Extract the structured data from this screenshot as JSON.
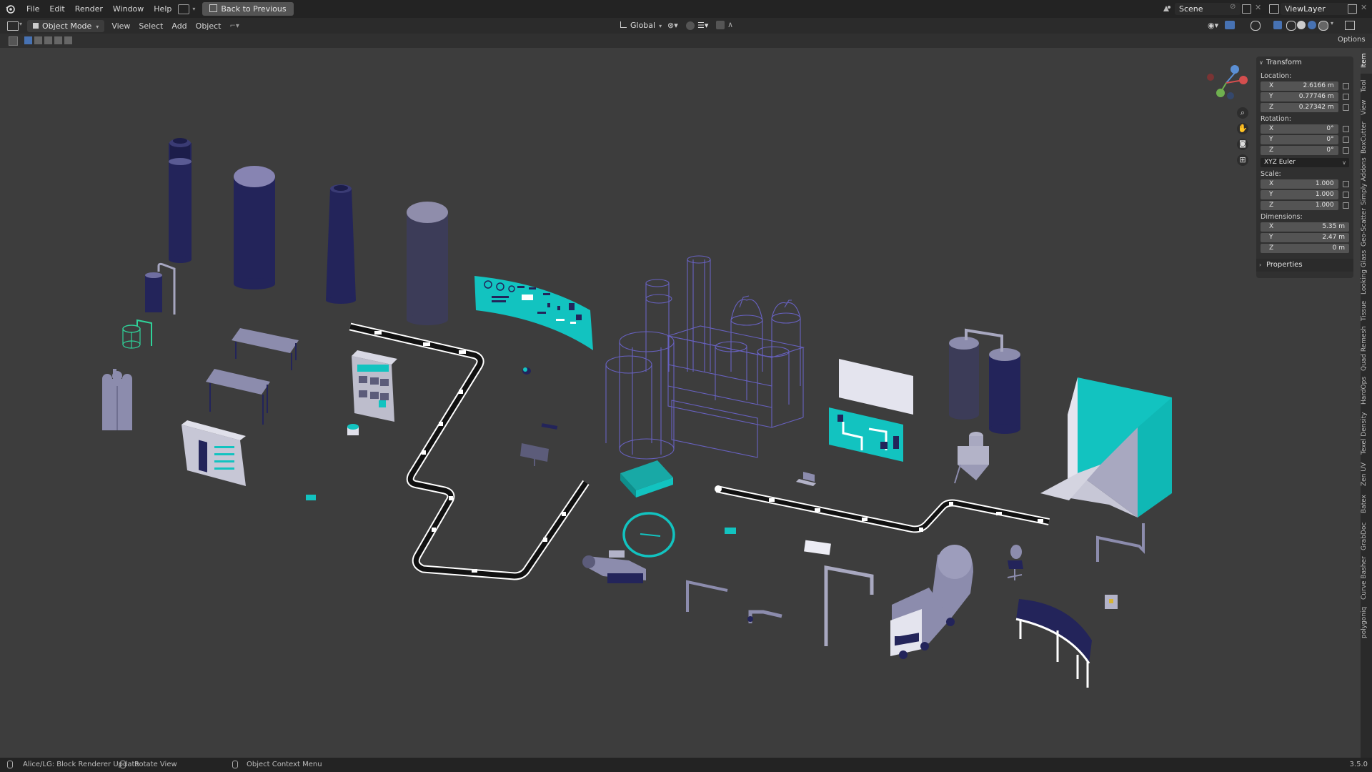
{
  "menu": {
    "items": [
      "File",
      "Edit",
      "Render",
      "Window",
      "Help"
    ],
    "back_label": "Back to Previous"
  },
  "scene": {
    "name": "Scene"
  },
  "view_layer": {
    "name": "ViewLayer"
  },
  "header": {
    "mode": "Object Mode",
    "menus": [
      "View",
      "Select",
      "Add",
      "Object"
    ],
    "transform_orientation": "Global",
    "options_label": "Options"
  },
  "npanel": {
    "transform_title": "Transform",
    "location_label": "Location:",
    "location": [
      {
        "axis": "X",
        "value": "2.6166 m"
      },
      {
        "axis": "Y",
        "value": "0.77746 m"
      },
      {
        "axis": "Z",
        "value": "0.27342 m"
      }
    ],
    "rotation_label": "Rotation:",
    "rotation": [
      {
        "axis": "X",
        "value": "0°"
      },
      {
        "axis": "Y",
        "value": "0°"
      },
      {
        "axis": "Z",
        "value": "0°"
      }
    ],
    "rotation_mode": "XYZ Euler",
    "scale_label": "Scale:",
    "scale": [
      {
        "axis": "X",
        "value": "1.000"
      },
      {
        "axis": "Y",
        "value": "1.000"
      },
      {
        "axis": "Z",
        "value": "1.000"
      }
    ],
    "dimensions_label": "Dimensions:",
    "dimensions": [
      {
        "axis": "X",
        "value": "5.35 m"
      },
      {
        "axis": "Y",
        "value": "2.47 m"
      },
      {
        "axis": "Z",
        "value": "0 m"
      }
    ],
    "properties_title": "Properties"
  },
  "side_tabs": [
    "Item",
    "Tool",
    "View",
    "BoxCutter",
    "Simply Addons",
    "Geo-Scatter",
    "Looking Glass",
    "Tissue",
    "Quad Remesh",
    "HardOps",
    "Texel Density",
    "Zen UV",
    "Batex",
    "GrabDoc",
    "Curve Basher",
    "polygoniq"
  ],
  "status": {
    "left": "Alice/LG: Block Renderer Update",
    "middle": "Rotate View",
    "right": "Object Context Menu",
    "version": "3.5.0"
  },
  "colors": {
    "navy": "#23245a",
    "slate": "#51507a",
    "lavender": "#8c8cad",
    "teal": "#12c3c0",
    "grid_bg": "#3d3d3d"
  }
}
